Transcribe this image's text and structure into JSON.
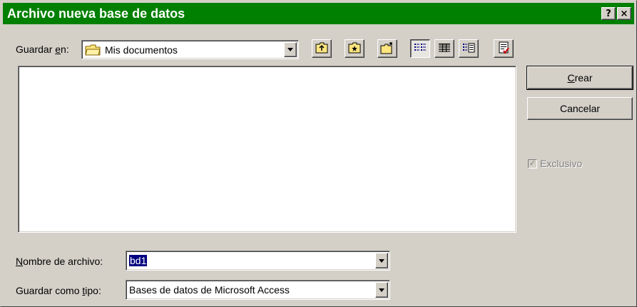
{
  "window": {
    "title": "Archivo nueva base de datos",
    "help_label": "?",
    "close_label": "×"
  },
  "save_in": {
    "label_pre": "Guardar ",
    "label_u": "e",
    "label_post": "n:",
    "value": "Mis documentos"
  },
  "toolbar": {
    "icons": [
      "up-one-level-icon",
      "favorites-icon",
      "create-new-folder-icon",
      "list-view-icon",
      "details-view-icon",
      "properties-view-icon",
      "commands-icon"
    ]
  },
  "buttons": {
    "create_u": "C",
    "create_rest": "rear",
    "cancel": "Cancelar"
  },
  "exclusive": {
    "label": "Exclusivo",
    "checked": true,
    "enabled": false
  },
  "filename": {
    "label_u": "N",
    "label_rest": "ombre de archivo:",
    "value": "bd1"
  },
  "filetype": {
    "label_pre": "Guardar como ",
    "label_u": "t",
    "label_post": "ipo:",
    "value": "Bases de datos de Microsoft Access"
  },
  "colors": {
    "titlebar": "#008000",
    "face": "#d4d0c8",
    "selection": "#000080"
  }
}
